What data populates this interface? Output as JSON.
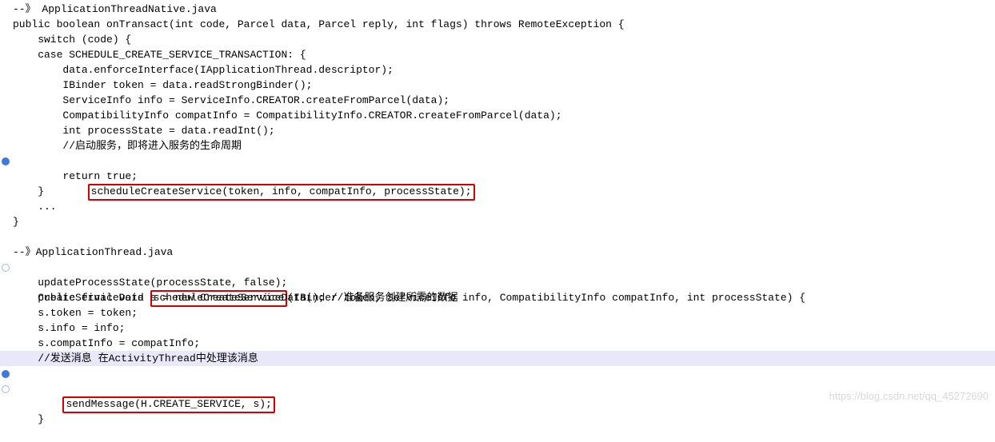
{
  "lines": {
    "l01": "--》 ApplicationThreadNative.java",
    "l02": "public boolean onTransact(int code, Parcel data, Parcel reply, int flags) throws RemoteException {",
    "l03": "    switch (code) {",
    "l04": "    case SCHEDULE_CREATE_SERVICE_TRANSACTION: {",
    "l05": "        data.enforceInterface(IApplicationThread.descriptor);",
    "l06": "        IBinder token = data.readStrongBinder();",
    "l07": "        ServiceInfo info = ServiceInfo.CREATOR.createFromParcel(data);",
    "l08": "        CompatibilityInfo compatInfo = CompatibilityInfo.CREATOR.createFromParcel(data);",
    "l09": "        int processState = data.readInt();",
    "l10": "        //启动服务，即将进入服务的生命周期",
    "l11a": "        ",
    "l11b": "scheduleCreateService(token, info, compatInfo, processState);",
    "l12": "        return true;",
    "l13": "    }",
    "l14": "    ...",
    "l15": "}",
    "l16": "",
    "l17": "--》ApplicationThread.java",
    "l18a": "public final void ",
    "l18b": "scheduleCreateService",
    "l18c": "(IBinder token, ServiceInfo info, CompatibilityInfo compatInfo, int processState) {",
    "l19": "    updateProcessState(processState, false);",
    "l20": "    CreateServiceData s = new CreateServiceData(); //准备服务创建所需的数据",
    "l21": "    s.token = token;",
    "l22": "    s.info = info;",
    "l23": "    s.compatInfo = compatInfo;",
    "l24": "    //发送消息 在ActivityThread中处理该消息",
    "l25a": "    ",
    "l25b": "sendMessage(H.CREATE_SERVICE, s);",
    "l26": "}"
  },
  "watermark": "https://blog.csdn.net/qq_45272690"
}
